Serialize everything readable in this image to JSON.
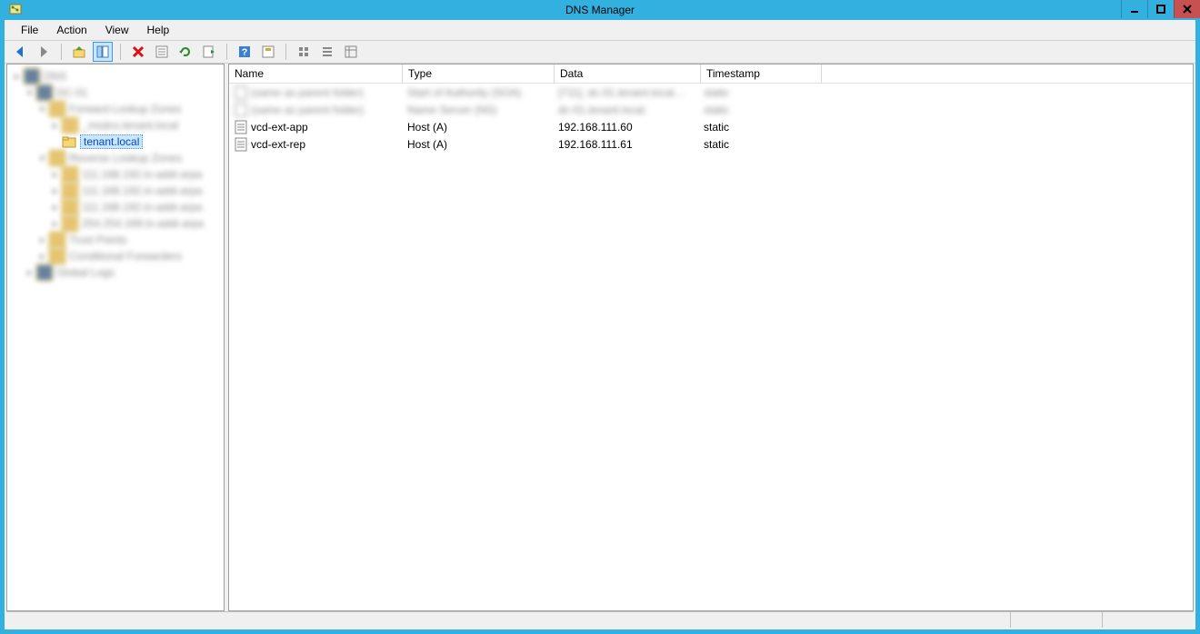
{
  "title": "DNS Manager",
  "menu": {
    "file": "File",
    "action": "Action",
    "view": "View",
    "help": "Help"
  },
  "tree": {
    "selected_label": "tenant.local"
  },
  "columns": {
    "name": "Name",
    "type": "Type",
    "data": "Data",
    "timestamp": "Timestamp"
  },
  "blurred_rows": [
    {
      "name": "(same as parent folder)",
      "type": "Start of Authority (SOA)",
      "data": "[711], dc-01.tenant.local…",
      "timestamp": "static"
    },
    {
      "name": "(same as parent folder)",
      "type": "Name Server (NS)",
      "data": "dc-01.tenant.local.",
      "timestamp": "static"
    }
  ],
  "rows": [
    {
      "name": "vcd-ext-app",
      "type": "Host (A)",
      "data": "192.168.111.60",
      "timestamp": "static"
    },
    {
      "name": "vcd-ext-rep",
      "type": "Host (A)",
      "data": "192.168.111.61",
      "timestamp": "static"
    }
  ]
}
